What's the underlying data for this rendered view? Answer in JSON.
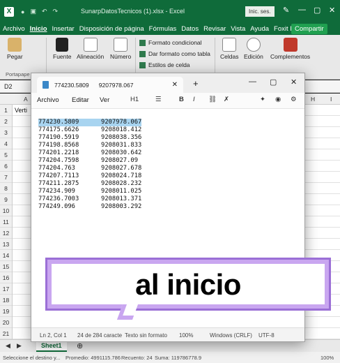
{
  "excel": {
    "title": "SunarpDatosTecnicos (1).xlsx  -  Excel",
    "signin": "Inic. ses.",
    "menu": [
      "Archivo",
      "Inicio",
      "Insertar",
      "Disposición de página",
      "Fórmulas",
      "Datos",
      "Revisar",
      "Vista",
      "Ayuda",
      "Foxit PDF"
    ],
    "active_menu": "Inicio",
    "share": "Compartir",
    "ribbon": {
      "pegar": "Pegar",
      "fuente": "Fuente",
      "alineacion": "Alineación",
      "numero": "Número",
      "formato_condicional": "Formato condicional",
      "dar_formato_tabla": "Dar formato como tabla",
      "estilos_celda": "Estilos de celda",
      "celdas": "Celdas",
      "edicion": "Edición",
      "complementos": "Complementos",
      "portapapeles": "Portapape"
    },
    "cell_ref": "D2",
    "col_headers": [
      "A",
      "H",
      "I"
    ],
    "rows": [
      "1",
      "2",
      "3",
      "4",
      "5",
      "6",
      "7",
      "8",
      "9",
      "10",
      "11",
      "12",
      "13",
      "14",
      "15",
      "16",
      "17",
      "18",
      "19",
      "20",
      "21"
    ],
    "cell_a1": "Verti",
    "sheet_tab": "Sheet1",
    "status": {
      "mode": "Seleccione el destino y...",
      "promedio": "Promedio: 4991115.786",
      "recuento": "Recuento: 24",
      "suma": "Suma: 119786778.9",
      "zoom": "100%"
    }
  },
  "notepad": {
    "tab_title": "774230.5809      9207978.067",
    "menu": [
      "Archivo",
      "Editar",
      "Ver"
    ],
    "heading_btn": "H1",
    "lines": [
      "774230.5809      9207978.067",
      "774175.6626      9208018.412",
      "774190.5919      9208038.356",
      "774198.8568      9208031.833",
      "774201.2218      9208030.642",
      "774204.7598      9208027.09",
      "774204.763       9208027.678",
      "774207.7113      9208024.718",
      "774211.2875      9208028.232",
      "774234.909       9208011.025",
      "774236.7003      9208013.371",
      "774249.096       9208003.292"
    ],
    "status": {
      "position": "Ln 2, Col 1",
      "chars": "24 de 284 caracte",
      "format": "Texto sin formato",
      "zoom": "100%",
      "eol": "Windows (CRLF)",
      "encoding": "UTF-8"
    }
  },
  "overlay": {
    "text": "al inicio"
  }
}
